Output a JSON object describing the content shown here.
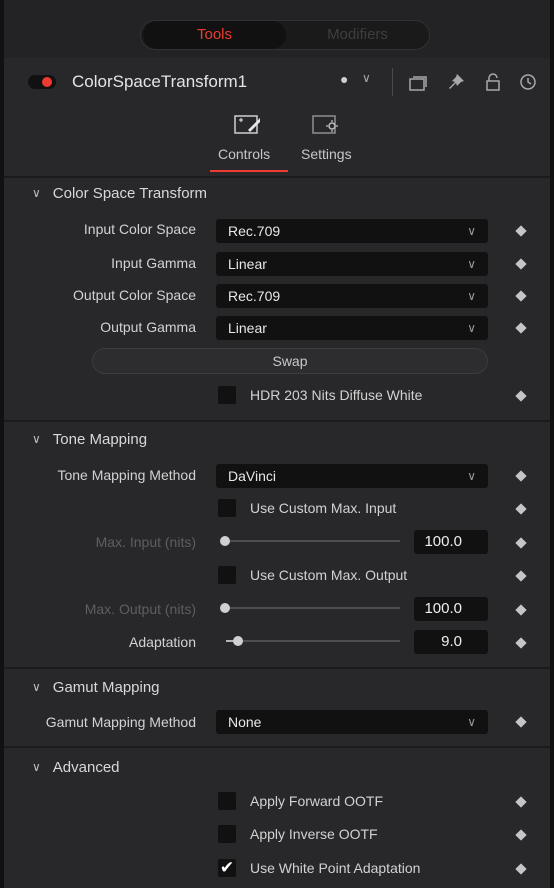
{
  "top_tabs": {
    "tools": "Tools",
    "modifiers": "Modifiers"
  },
  "header": {
    "title": "ColorSpaceTransform1",
    "icons": [
      "power-toggle-icon",
      "color-dot-icon",
      "chevron-down-icon",
      "versions-icon",
      "pin-icon",
      "lock-icon",
      "reset-icon"
    ]
  },
  "subtabs": {
    "controls": "Controls",
    "settings": "Settings"
  },
  "color_space_transform": {
    "title": "Color Space Transform",
    "input_color_space": {
      "label": "Input Color Space",
      "value": "Rec.709"
    },
    "input_gamma": {
      "label": "Input Gamma",
      "value": "Linear"
    },
    "output_color_space": {
      "label": "Output Color Space",
      "value": "Rec.709"
    },
    "output_gamma": {
      "label": "Output Gamma",
      "value": "Linear"
    },
    "swap": "Swap",
    "hdr_diffuse_white": {
      "label": "HDR 203 Nits Diffuse White",
      "checked": false
    }
  },
  "tone_mapping": {
    "title": "Tone Mapping",
    "method": {
      "label": "Tone Mapping Method",
      "value": "DaVinci"
    },
    "use_custom_max_input": {
      "label": "Use Custom Max. Input",
      "checked": false
    },
    "max_input": {
      "label": "Max. Input (nits)",
      "value": "100.0",
      "enabled": false
    },
    "use_custom_max_output": {
      "label": "Use Custom Max. Output",
      "checked": false
    },
    "max_output": {
      "label": "Max. Output (nits)",
      "value": "100.0",
      "enabled": false
    },
    "adaptation": {
      "label": "Adaptation",
      "value": "9.0"
    }
  },
  "gamut_mapping": {
    "title": "Gamut Mapping",
    "method": {
      "label": "Gamut Mapping Method",
      "value": "None"
    }
  },
  "advanced": {
    "title": "Advanced",
    "apply_forward_ootf": {
      "label": "Apply Forward OOTF",
      "checked": false
    },
    "apply_inverse_ootf": {
      "label": "Apply Inverse OOTF",
      "checked": false
    },
    "use_white_point_adaptation": {
      "label": "Use White Point Adaptation",
      "checked": true
    }
  },
  "colors": {
    "accent": "#ef3a2f",
    "panel": "#28282b",
    "field": "#111112"
  }
}
